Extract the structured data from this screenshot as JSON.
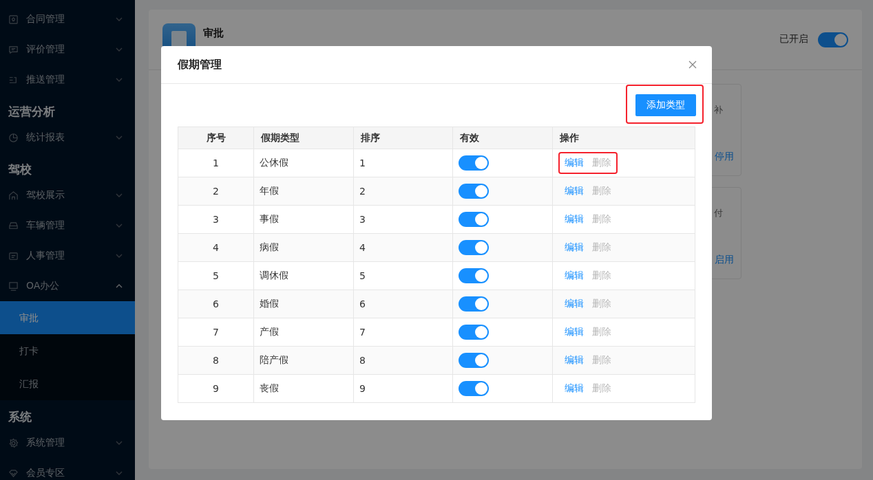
{
  "sidebar": {
    "groups": [
      {
        "items": [
          {
            "label": "合同管理",
            "expanded": false
          },
          {
            "label": "评价管理",
            "expanded": false
          },
          {
            "label": "推送管理",
            "expanded": false
          }
        ]
      },
      {
        "title": "运营分析",
        "items": [
          {
            "label": "统计报表",
            "expanded": false
          }
        ]
      },
      {
        "title": "驾校",
        "items": [
          {
            "label": "驾校展示",
            "expanded": false
          },
          {
            "label": "车辆管理",
            "expanded": false
          },
          {
            "label": "人事管理",
            "expanded": false
          },
          {
            "label": "OA办公",
            "expanded": true,
            "children": [
              {
                "label": "审批",
                "selected": true
              },
              {
                "label": "打卡",
                "selected": false
              },
              {
                "label": "汇报",
                "selected": false
              }
            ]
          }
        ]
      },
      {
        "title": "系统",
        "items": [
          {
            "label": "系统管理",
            "expanded": false
          },
          {
            "label": "会员专区",
            "expanded": false
          }
        ]
      }
    ]
  },
  "app_header": {
    "title": "审批",
    "status": "已开启",
    "on": true
  },
  "cards": [
    {
      "description": "补",
      "action": "停用"
    },
    {
      "description": "付",
      "action": "启用"
    }
  ],
  "dialog": {
    "title": "假期管理",
    "add_button": {
      "label": "添加类型",
      "highlighted": true
    },
    "table": {
      "columns": [
        "序号",
        "假期类型",
        "排序",
        "有效",
        "操作"
      ],
      "rows": [
        {
          "index": "1",
          "type": "公休假",
          "order": "1",
          "on": true,
          "edit": "编辑",
          "delete": "删除",
          "highlighted": true
        },
        {
          "index": "2",
          "type": "年假",
          "order": "2",
          "on": true,
          "edit": "编辑",
          "delete": "删除",
          "highlighted": false
        },
        {
          "index": "3",
          "type": "事假",
          "order": "3",
          "on": true,
          "edit": "编辑",
          "delete": "删除",
          "highlighted": false
        },
        {
          "index": "4",
          "type": "病假",
          "order": "4",
          "on": true,
          "edit": "编辑",
          "delete": "删除",
          "highlighted": false
        },
        {
          "index": "5",
          "type": "调休假",
          "order": "5",
          "on": true,
          "edit": "编辑",
          "delete": "删除",
          "highlighted": false
        },
        {
          "index": "6",
          "type": "婚假",
          "order": "6",
          "on": true,
          "edit": "编辑",
          "delete": "删除",
          "highlighted": false
        },
        {
          "index": "7",
          "type": "产假",
          "order": "7",
          "on": true,
          "edit": "编辑",
          "delete": "删除",
          "highlighted": false
        },
        {
          "index": "8",
          "type": "陪产假",
          "order": "8",
          "on": true,
          "edit": "编辑",
          "delete": "删除",
          "highlighted": false
        },
        {
          "index": "9",
          "type": "丧假",
          "order": "9",
          "on": true,
          "edit": "编辑",
          "delete": "删除",
          "highlighted": false
        }
      ]
    }
  }
}
